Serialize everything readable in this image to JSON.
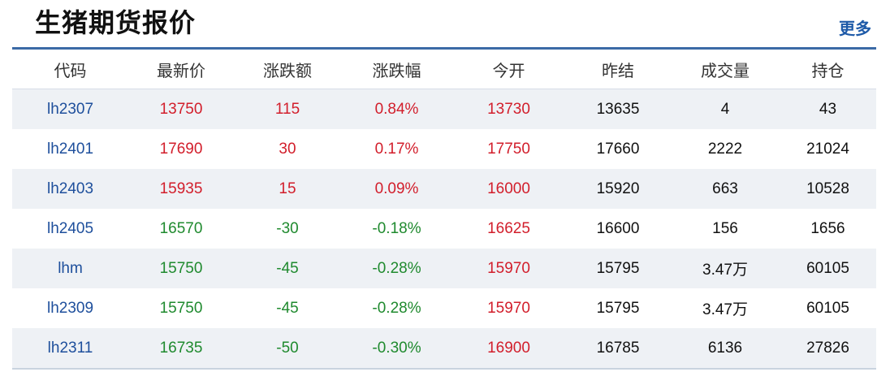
{
  "page": {
    "title": "生猪期货报价",
    "more_label": "更多"
  },
  "colors": {
    "up": "#d21e2b",
    "down": "#1f8a2e",
    "code": "#1e4f9c",
    "header_rule": "#3b6aa6",
    "row_alt": "#eef1f5"
  },
  "table": {
    "headers": [
      "代码",
      "最新价",
      "涨跌额",
      "涨跌幅",
      "今开",
      "昨结",
      "成交量",
      "持仓"
    ],
    "rows": [
      {
        "code": "lh2307",
        "last": "13750",
        "change": "115",
        "pct": "0.84%",
        "open": "13730",
        "settle": "13635",
        "volume": "4",
        "oi": "43",
        "dir": "up",
        "open_dir": "up"
      },
      {
        "code": "lh2401",
        "last": "17690",
        "change": "30",
        "pct": "0.17%",
        "open": "17750",
        "settle": "17660",
        "volume": "2222",
        "oi": "21024",
        "dir": "up",
        "open_dir": "up"
      },
      {
        "code": "lh2403",
        "last": "15935",
        "change": "15",
        "pct": "0.09%",
        "open": "16000",
        "settle": "15920",
        "volume": "663",
        "oi": "10528",
        "dir": "up",
        "open_dir": "up"
      },
      {
        "code": "lh2405",
        "last": "16570",
        "change": "-30",
        "pct": "-0.18%",
        "open": "16625",
        "settle": "16600",
        "volume": "156",
        "oi": "1656",
        "dir": "down",
        "open_dir": "up"
      },
      {
        "code": "lhm",
        "last": "15750",
        "change": "-45",
        "pct": "-0.28%",
        "open": "15970",
        "settle": "15795",
        "volume": "3.47万",
        "oi": "60105",
        "dir": "down",
        "open_dir": "up"
      },
      {
        "code": "lh2309",
        "last": "15750",
        "change": "-45",
        "pct": "-0.28%",
        "open": "15970",
        "settle": "15795",
        "volume": "3.47万",
        "oi": "60105",
        "dir": "down",
        "open_dir": "up"
      },
      {
        "code": "lh2311",
        "last": "16735",
        "change": "-50",
        "pct": "-0.30%",
        "open": "16900",
        "settle": "16785",
        "volume": "6136",
        "oi": "27826",
        "dir": "down",
        "open_dir": "up"
      }
    ]
  }
}
